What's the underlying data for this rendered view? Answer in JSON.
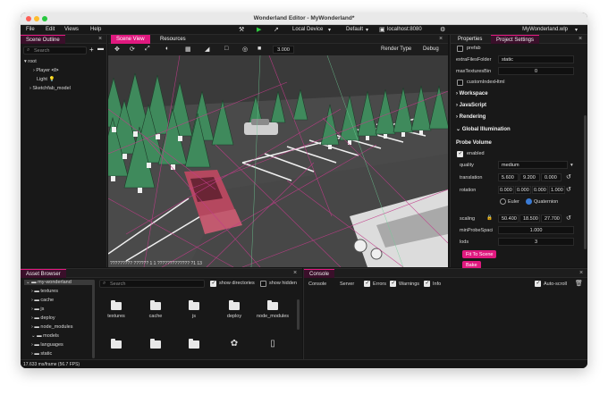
{
  "window": {
    "title": "Wonderland Editor - MyWonderland*"
  },
  "menubar": {
    "items": [
      "File",
      "Edit",
      "Views",
      "Help"
    ],
    "toolbar": {
      "device": "Local Device",
      "preset": "Default",
      "server": "localhost:8080"
    },
    "project_file": "MyWonderland.wlp"
  },
  "scene_outline": {
    "tab": "Scene Outline",
    "search_placeholder": "Search",
    "tree": {
      "root": "root",
      "player": "Player",
      "light": "Light",
      "model": "Sketchfab_model"
    }
  },
  "viewport": {
    "tabs": [
      "Scene View",
      "Resources"
    ],
    "zoom": "3.000",
    "render_type": "Render Type",
    "debug": "Debug",
    "status": "????????? ?????? 1 1 ????????????? ?1 13"
  },
  "properties": {
    "tabs": [
      "Properties",
      "Project Settings"
    ],
    "prefab_label": "prefab",
    "extra_files_folder": {
      "label": "extraFilesFolder",
      "value": "static"
    },
    "max_textures": {
      "label": "maxTexturesBin",
      "value": "0"
    },
    "custom_index": "customIndexHtml",
    "sections": [
      "Workspace",
      "JavaScript",
      "Rendering",
      "Global Illumination"
    ],
    "probe_volume": {
      "title": "Probe Volume",
      "enabled_label": "enabled",
      "quality": {
        "label": "quality",
        "value": "medium"
      },
      "translation": {
        "label": "translation",
        "values": [
          "5.600",
          "9.200",
          "0.000"
        ]
      },
      "rotation": {
        "label": "rotation",
        "values": [
          "0.000",
          "0.000",
          "0.000",
          "1.000"
        ]
      },
      "rotation_modes": [
        "Euler",
        "Quaternion"
      ],
      "scaling": {
        "label": "scaling",
        "values": [
          "50.400",
          "18.500",
          "27.700"
        ]
      },
      "min_probe_spacing": {
        "label": "minProbeSpaci",
        "value": "1.000"
      },
      "lods": {
        "label": "lods",
        "value": "3"
      },
      "fit_to_scene": "Fit To Scene",
      "bake": "Bake"
    }
  },
  "asset_browser": {
    "tab": "Asset Browser",
    "search_placeholder": "Search",
    "show_directories": "show directories",
    "show_hidden": "show hidden",
    "tree": [
      "my-wonderland",
      "textures",
      "cache",
      "js",
      "deploy",
      "node_modules",
      "models",
      "languages",
      "static"
    ],
    "grid": [
      "textures",
      "cache",
      "js",
      "deploy",
      "node_modules"
    ]
  },
  "console": {
    "tab": "Console",
    "subtabs": [
      "Console",
      "Server"
    ],
    "filters": [
      "Errors",
      "Warnings",
      "Info"
    ],
    "autoscroll": "Auto-scroll"
  },
  "statusbar": {
    "fps": "17.633 ms/frame (56.7 FPS)"
  },
  "colors": {
    "accent": "#e0197f",
    "background": "#141414",
    "panel": "#181818"
  }
}
